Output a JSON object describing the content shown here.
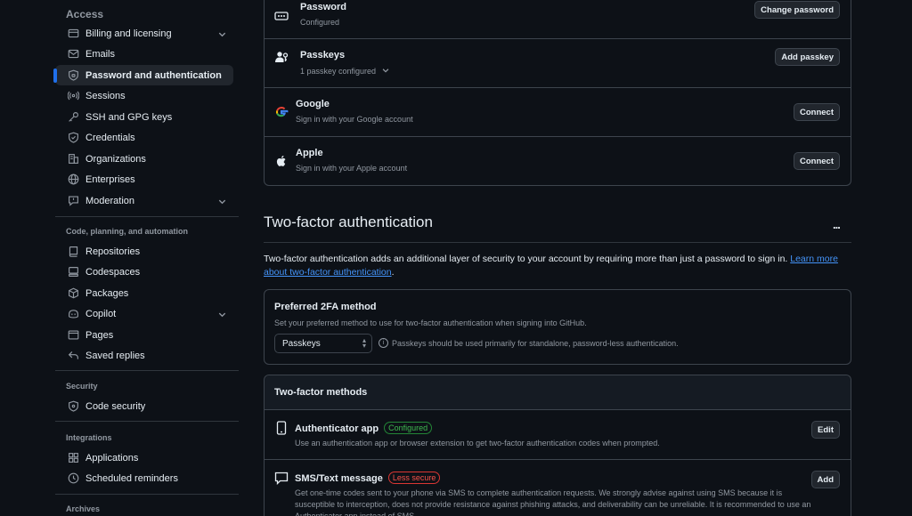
{
  "sidebar": {
    "sections": [
      {
        "label": "Access"
      },
      {
        "label": "Code, planning, and automation"
      },
      {
        "label": "Security"
      },
      {
        "label": "Integrations"
      },
      {
        "label": "Archives"
      }
    ],
    "items": [
      {
        "label": "Billing and licensing",
        "icon": "credit-card-icon"
      },
      {
        "label": "Emails",
        "icon": "mail-icon"
      },
      {
        "label": "Password and authentication",
        "icon": "shield-lock-icon"
      },
      {
        "label": "Sessions",
        "icon": "broadcast-icon"
      },
      {
        "label": "SSH and GPG keys",
        "icon": "key-icon"
      },
      {
        "label": "Credentials",
        "icon": "shield-check-icon"
      },
      {
        "label": "Organizations",
        "icon": "organization-icon"
      },
      {
        "label": "Enterprises",
        "icon": "globe-icon"
      },
      {
        "label": "Moderation",
        "icon": "report-icon"
      },
      {
        "label": "Repositories",
        "icon": "repo-icon"
      },
      {
        "label": "Codespaces",
        "icon": "codespaces-icon"
      },
      {
        "label": "Packages",
        "icon": "package-icon"
      },
      {
        "label": "Copilot",
        "icon": "copilot-icon"
      },
      {
        "label": "Pages",
        "icon": "browser-icon"
      },
      {
        "label": "Saved replies",
        "icon": "reply-icon"
      },
      {
        "label": "Code security",
        "icon": "shield-icon"
      },
      {
        "label": "Applications",
        "icon": "apps-icon"
      },
      {
        "label": "Scheduled reminders",
        "icon": "clock-icon"
      }
    ]
  },
  "auth_methods": [
    {
      "title": "Password",
      "subtitle": "Configured",
      "button": "Change password"
    },
    {
      "title": "Passkeys",
      "subtitle": "1 passkey configured",
      "button": "Add passkey"
    },
    {
      "title": "Google",
      "subtitle": "Sign in with your Google account",
      "button": "Connect"
    },
    {
      "title": "Apple",
      "subtitle": "Sign in with your Apple account",
      "button": "Connect"
    }
  ],
  "two_factor": {
    "heading": "Two-factor authentication",
    "kebab": "...",
    "description": "Two-factor authentication adds an additional layer of security to your account by requiring more than just a password to sign in.",
    "learn_more": "Learn more about two-factor authentication",
    "period": ".",
    "preferred": {
      "title": "Preferred 2FA method",
      "subtitle": "Set your preferred method to use for two-factor authentication when signing into GitHub.",
      "selected": "Passkeys",
      "note": "Passkeys should be used primarily for standalone, password-less authentication."
    },
    "methods_header": "Two-factor methods",
    "methods": [
      {
        "title": "Authenticator app",
        "badge": "Configured",
        "badge_color": "#3fb950",
        "desc": "Use an authentication app or browser extension to get two-factor authentication codes when prompted.",
        "button": "Edit"
      },
      {
        "title": "SMS/Text message",
        "badge": "Less secure",
        "badge_color": "#f85149",
        "desc": "Get one-time codes sent to your phone via SMS to complete authentication requests. We strongly advise against using SMS because it is susceptible to interception, does not provide resistance against phishing attacks, and deliverability can be unreliable. It is recommended to use an Authenticator app instead of SMS.",
        "button": "Add"
      }
    ]
  },
  "colors": {
    "accent": "#1f6feb",
    "link": "#4493f8",
    "bg": "#0d1117",
    "border": "#3d444d"
  }
}
